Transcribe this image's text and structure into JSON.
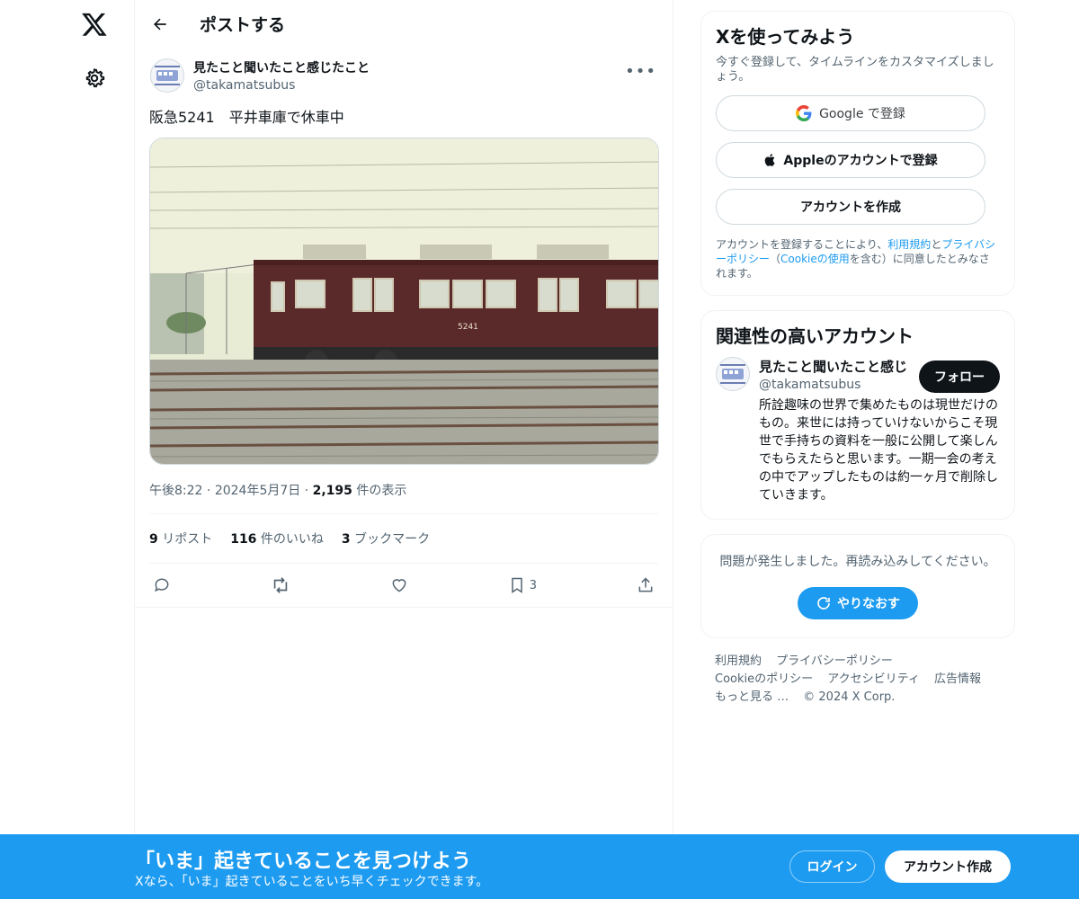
{
  "nav": {
    "logo_icon": "x-logo-icon",
    "settings_icon": "gear-icon"
  },
  "header": {
    "title": "ポストする",
    "back_icon": "arrow-left-icon"
  },
  "post": {
    "display_name": "見たこと聞いたこと感じたこと",
    "handle": "@takamatsubus",
    "text": "阪急5241　平井車庫で休車中",
    "time": "午後8:22",
    "date": "2024年5月7日",
    "views_count": "2,195",
    "views_label": "件の表示",
    "reposts_count": "9",
    "reposts_label": "リポスト",
    "likes_count": "116",
    "likes_label": "件のいいね",
    "bookmarks_count": "3",
    "bookmarks_label": "ブックマーク",
    "bookmark_action_count": "3",
    "train_number": "5241"
  },
  "signup_card": {
    "title": "Xを使ってみよう",
    "subtitle": "今すぐ登録して、タイムラインをカスタマイズしましょう。",
    "google_label": "Google で登録",
    "apple_label": "Appleのアカウントで登録",
    "create_label": "アカウントを作成",
    "legal_1": "アカウントを登録することにより、",
    "terms_link": "利用規約",
    "legal_2": "と",
    "privacy_link": "プライバシーポリシー",
    "legal_3": "（",
    "cookie_link": "Cookieの使用",
    "legal_4": "を含む）に同意したとみなされます。"
  },
  "related": {
    "title": "関連性の高いアカウント",
    "name": "見たこと聞いたこと感じ",
    "handle": "@takamatsubus",
    "follow_label": "フォロー",
    "bio": "所詮趣味の世界で集めたものは現世だけのもの。来世には持っていけないからこそ現世で手持ちの資料を一般に公開して楽しんでもらえたらと思います。一期一会の考えの中でアップしたものは約一ヶ月で削除していきます。"
  },
  "error_card": {
    "message": "問題が発生しました。再読み込みしてください。",
    "retry_label": "やりなおす"
  },
  "footer": {
    "links": [
      "利用規約",
      "プライバシーポリシー",
      "Cookieのポリシー",
      "アクセシビリティ",
      "広告情報",
      "もっと見る …"
    ],
    "copyright": "© 2024 X Corp."
  },
  "bottom_bar": {
    "title": "「いま」起きていることを見つけよう",
    "subtitle": "Xなら、「いま」起きていることをいち早くチェックできます。",
    "login_label": "ログイン",
    "signup_label": "アカウント作成"
  },
  "colors": {
    "accent": "#1d9bf0",
    "text": "#0f1419",
    "muted": "#536471",
    "train": "#5a2a2a"
  }
}
